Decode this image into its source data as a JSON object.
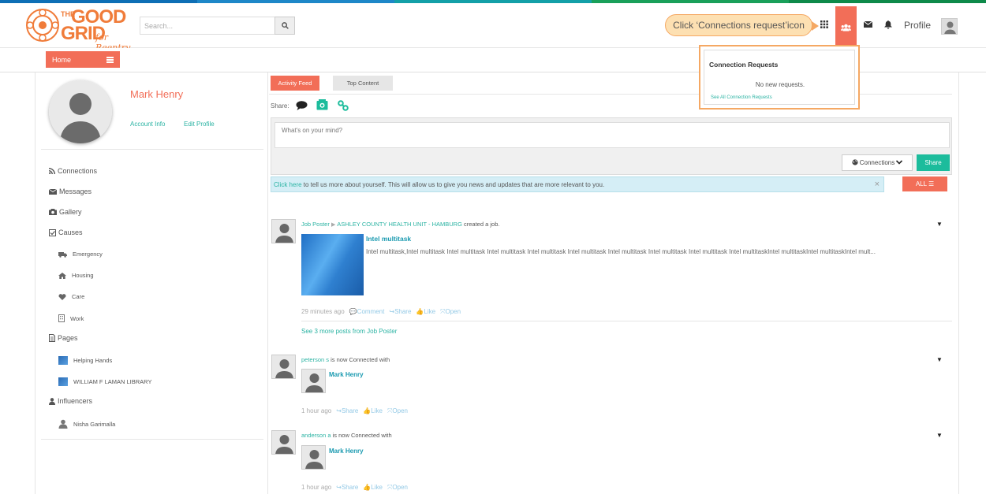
{
  "colors": {
    "accent": "#f26e58",
    "teal": "#1cbc9c",
    "link": "#2bb3a3",
    "stripe": [
      "#0e6fb5",
      "#1e87c8",
      "#13a0a8",
      "#19a05a",
      "#0e8a4a"
    ]
  },
  "brand": {
    "the": "THE",
    "good": "GOOD",
    "grid": "GRID",
    "tagline": "for Reentry"
  },
  "header": {
    "search_placeholder": "Search...",
    "tooltip": "Click ‘Connections request’icon",
    "profile_label": "Profile",
    "icons": [
      "grid-icon",
      "users-icon",
      "envelope-icon",
      "bell-icon"
    ]
  },
  "subbar": {
    "home_label": "Home"
  },
  "profile": {
    "name": "Mark Henry",
    "account_info": "Account Info",
    "edit_profile": "Edit Profile"
  },
  "sidebar": {
    "items": [
      {
        "label": "Connections",
        "icon": "rss-icon"
      },
      {
        "label": "Messages",
        "icon": "envelope-icon"
      },
      {
        "label": "Gallery",
        "icon": "camera-icon"
      },
      {
        "label": "Causes",
        "icon": "check-square-icon"
      },
      {
        "label": "Pages",
        "icon": "file-icon"
      },
      {
        "label": "Influencers",
        "icon": "user-icon"
      }
    ],
    "causes": [
      "Emergency",
      "Housing",
      "Care",
      "Work"
    ],
    "pages": [
      "Helping Hands",
      "WILLIAM F LAMAN LIBRARY"
    ],
    "influencers": [
      "Nisha Garimalla"
    ]
  },
  "feed": {
    "tab_activity": "Activity Feed",
    "tab_top": "Top Content",
    "share_label": "Share:",
    "composer_placeholder": "What's on your mind?",
    "privacy": "Connections",
    "share_button": "Share",
    "info_link": "Click here",
    "info_text": " to tell us more about yourself. This will allow us to give you news and updates that are more relevant to you.",
    "all_button": "ALL",
    "posts": [
      {
        "author": "Job Poster",
        "target": "ASHLEY COUNTY HEALTH UNIT - HAMBURG",
        "action": " created a job.",
        "title": "Intel multitask",
        "desc": "Intel multitask,Intel multitask Intel multitask Intel multitask Intel multitask Intel multitask Intel multitask Intel multitask Intel multitask  Intel multitaskIntel multitaskIntel multitaskIntel mult...",
        "time": "29 minutes ago",
        "comment": "Comment",
        "share": "Share",
        "like": "Like",
        "open": "Open",
        "see_more": "See 3 more posts from Job Poster"
      },
      {
        "author": "peterson s",
        "action": " is now Connected with",
        "connected": "Mark Henry",
        "time": "1 hour ago",
        "share": "Share",
        "like": "Like",
        "open": "Open"
      },
      {
        "author": "anderson a",
        "action": " is now Connected with",
        "connected": "Mark Henry",
        "time": "1 hour ago",
        "share": "Share",
        "like": "Like",
        "open": "Open"
      }
    ]
  },
  "popup": {
    "title": "Connection Requests",
    "empty": "No new requests.",
    "see_all": "See All Connection Requests"
  }
}
